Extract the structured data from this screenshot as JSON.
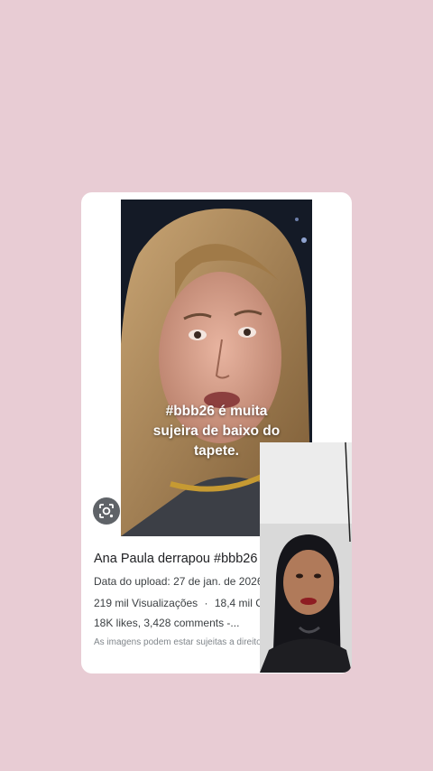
{
  "result_card": {
    "video_caption": "#bbb26 é muita\nsujeira de baixo do\ntapete.",
    "title": "Ana Paula derrapou #bbb26",
    "upload_date": "Data do upload: 27 de jan. de 2026 ·",
    "views": "219 mil Visualizações",
    "separator": "·",
    "followers": "18,4 mil Cur",
    "engagement": "18K likes, 3,428 comments -...",
    "disclaimer": "As imagens podem estar sujeitas a direito"
  },
  "icons": {
    "lens": "google-lens-icon"
  },
  "colors": {
    "background": "#e8ccd4",
    "card": "#ffffff",
    "lens_button": "#5f6368"
  }
}
